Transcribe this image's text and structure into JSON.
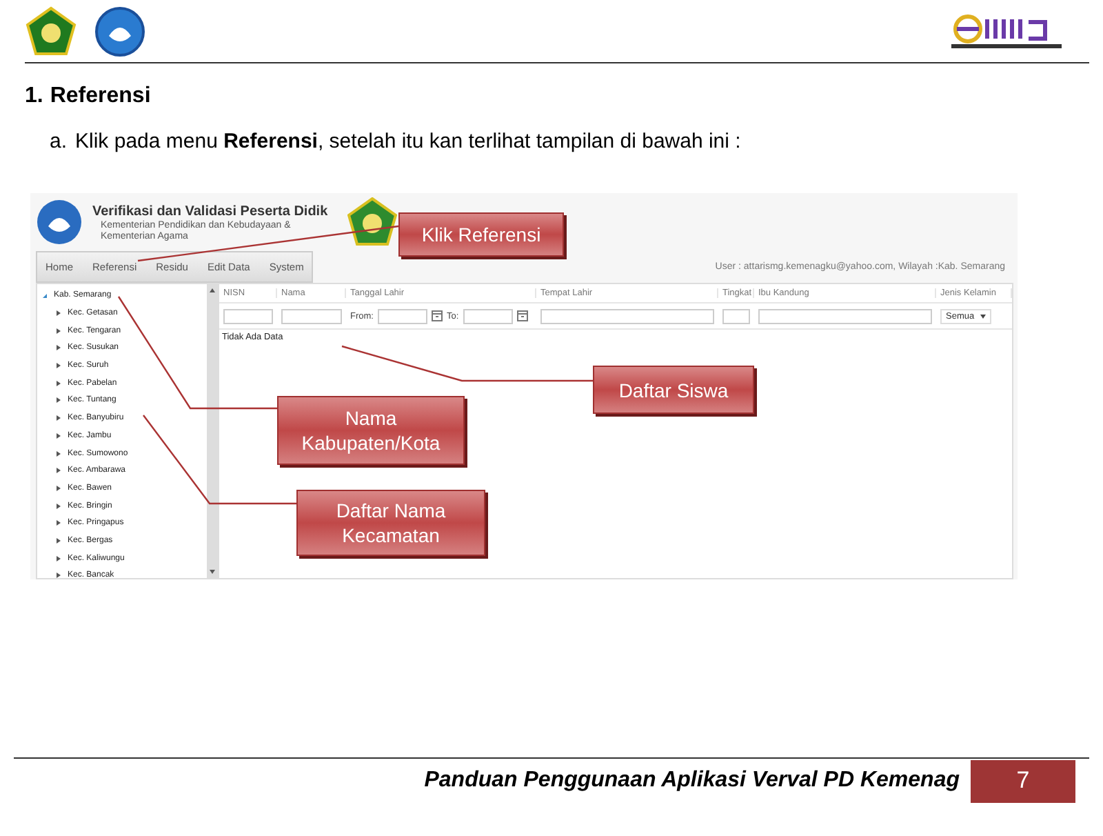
{
  "heading": {
    "number": "1.",
    "title": "Referensi"
  },
  "instruction": {
    "marker": "a.",
    "text": "Klik pada menu **Referensi**, setelah itu kan terlihat tampilan di bawah ini :"
  },
  "app": {
    "title": "Verifikasi dan Validasi Peserta Didik",
    "subtitle_lines": [
      "Kementerian Pendidikan dan Kebudayaan &",
      "Kementerian Agama"
    ],
    "menu": [
      "Home",
      "Referensi",
      "Residu",
      "Edit Data",
      "System"
    ],
    "user_info": "User : attarismg.kemenagku@yahoo.com, Wilayah :Kab. Semarang",
    "tree": [
      {
        "label": "Kab. Semarang",
        "expanded": true,
        "children": [
          {
            "label": "Kec. Getasan",
            "expanded": false
          },
          {
            "label": "Kec. Tengaran",
            "expanded": false
          },
          {
            "label": "Kec. Susukan",
            "expanded": false
          },
          {
            "label": "Kec. Suruh",
            "expanded": false
          },
          {
            "label": "Kec. Pabelan",
            "expanded": false
          },
          {
            "label": "Kec. Tuntang",
            "expanded": false
          },
          {
            "label": "Kec. Banyubiru",
            "expanded": false
          },
          {
            "label": "Kec. Jambu",
            "expanded": false
          },
          {
            "label": "Kec. Sumowono",
            "expanded": false
          },
          {
            "label": "Kec. Ambarawa",
            "expanded": false
          },
          {
            "label": "Kec. Bawen",
            "expanded": false
          },
          {
            "label": "Kec. Bringin",
            "expanded": false
          },
          {
            "label": "Kec. Pringapus",
            "expanded": false
          },
          {
            "label": "Kec. Bergas",
            "expanded": false
          },
          {
            "label": "Kec. Kaliwungu",
            "expanded": false
          },
          {
            "label": "Kec. Bancak",
            "expanded": false
          }
        ]
      }
    ],
    "columns": [
      {
        "label": "NISN",
        "kind": "text"
      },
      {
        "label": "Nama",
        "kind": "text"
      },
      {
        "label": "Tanggal Lahir",
        "kind": "daterange",
        "from": "From:",
        "to": "To:"
      },
      {
        "label": "Tempat Lahir",
        "kind": "text"
      },
      {
        "label": "Tingkat",
        "kind": "text"
      },
      {
        "label": "Ibu Kandung",
        "kind": "text"
      },
      {
        "label": "Jenis Kelamin",
        "kind": "select",
        "value": "Semua"
      }
    ],
    "empty_message": "Tidak Ada Data"
  },
  "callouts": [
    {
      "lines": [
        "Klik Referensi"
      ]
    },
    {
      "lines": [
        "Daftar Siswa"
      ]
    },
    {
      "lines": [
        "Nama",
        "Kabupaten/Kota"
      ]
    },
    {
      "lines": [
        "Daftar Nama",
        "Kecamatan"
      ]
    }
  ],
  "footer": {
    "title": "Panduan Penggunaan Aplikasi Verval PD Kemenag",
    "page": "7"
  }
}
